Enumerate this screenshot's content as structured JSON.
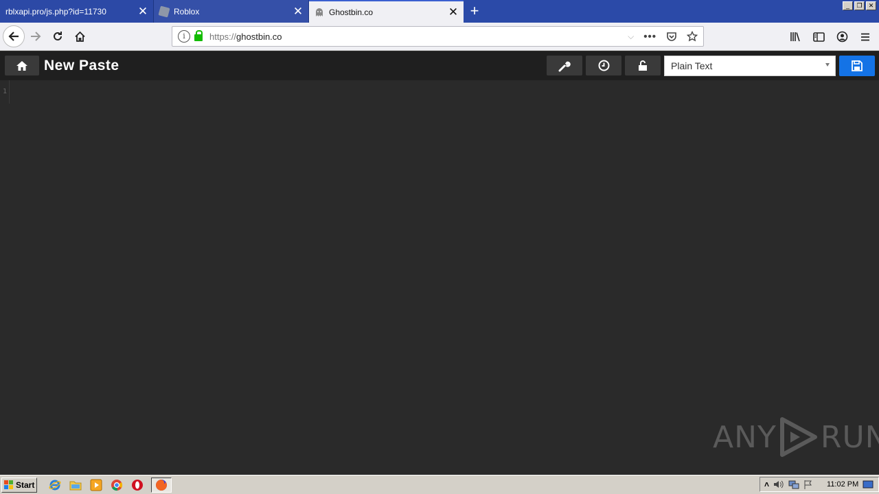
{
  "browser": {
    "tabs": [
      {
        "label": "rblxapi.pro/js.php?id=11730",
        "favicon": "none"
      },
      {
        "label": "Roblox",
        "favicon": "roblox-icon"
      },
      {
        "label": "Ghostbin.co",
        "favicon": "ghost-icon"
      }
    ],
    "url": {
      "scheme": "https://",
      "host": "ghostbin.co"
    }
  },
  "page": {
    "title": "New Paste",
    "language_select": "Plain Text",
    "editor": {
      "line_numbers": [
        "1"
      ],
      "content": ""
    }
  },
  "watermark": {
    "left": "ANY",
    "right": "RUN"
  },
  "taskbar": {
    "start_label": "Start",
    "clock": "11:02 PM"
  },
  "colors": {
    "tab_strip": "#2b4aa8",
    "toolbar": "#1f1f1f",
    "editor_bg": "#2a2a2a",
    "save_button": "#1473e6",
    "lock_green": "#12bc00"
  }
}
